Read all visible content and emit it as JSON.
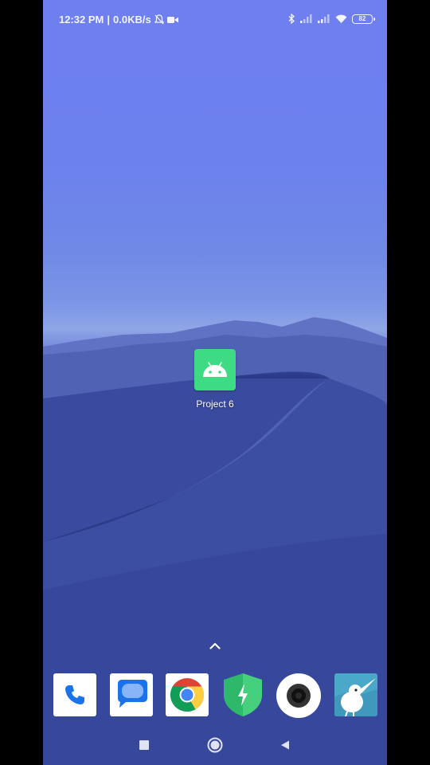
{
  "status_bar": {
    "time": "12:32 PM",
    "separator": "|",
    "network_speed": "0.0KB/s",
    "battery_level": "82"
  },
  "home": {
    "app_icon": {
      "label": "Project 6",
      "icon": "android-icon",
      "color": "#3ddc84"
    }
  },
  "dock": {
    "apps": [
      {
        "name": "Phone",
        "icon": "phone-icon"
      },
      {
        "name": "Messages",
        "icon": "messages-icon"
      },
      {
        "name": "Chrome",
        "icon": "chrome-icon"
      },
      {
        "name": "Security",
        "icon": "security-shield-icon"
      },
      {
        "name": "Camera",
        "icon": "camera-icon"
      },
      {
        "name": "Kiwi Browser",
        "icon": "kiwi-bird-icon"
      }
    ]
  },
  "nav_bar": {
    "buttons": [
      "recents",
      "home",
      "back"
    ]
  }
}
